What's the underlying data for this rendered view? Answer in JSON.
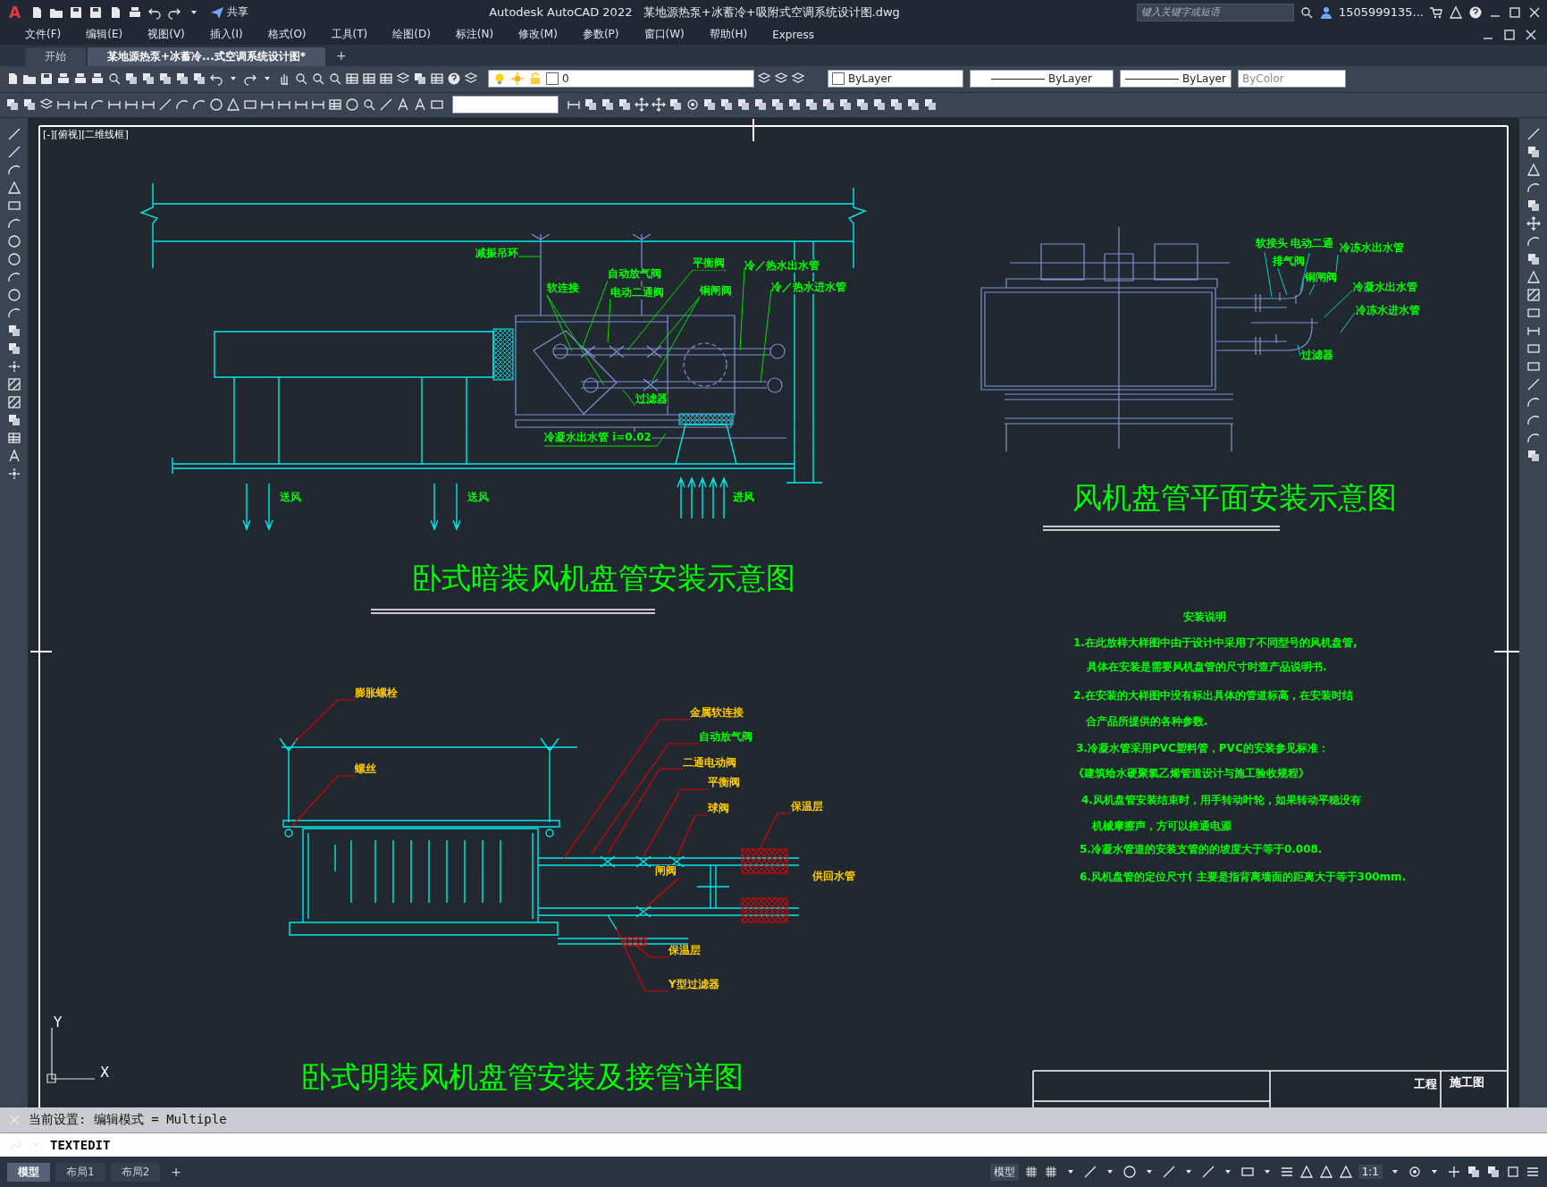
{
  "title_bar": {
    "app_menu": "A",
    "share": "共享",
    "title": "Autodesk AutoCAD 2022   某地源热泵+冰蓄冷+吸附式空调系统设计图.dwg",
    "search": {
      "placeholder": "键入关键字或短语"
    },
    "user": "1505999135..."
  },
  "menu_bar": [
    "文件(F)",
    "编辑(E)",
    "视图(V)",
    "插入(I)",
    "格式(O)",
    "工具(T)",
    "绘图(D)",
    "标注(N)",
    "修改(M)",
    "参数(P)",
    "窗口(W)",
    "帮助(H)",
    "Express"
  ],
  "file_tabs": [
    {
      "label": "开始",
      "selected": false
    },
    {
      "label": "某地源热泵+冰蓄冷...式空调系统设计图*",
      "selected": true
    }
  ],
  "new_tab": "+",
  "properties_toolbar": {
    "layer": "0",
    "color_control": "ByLayer",
    "linetype": "ByLayer",
    "lineweight": "ByLayer",
    "plot_style": "ByColor"
  },
  "drawing": {
    "labels": [
      {
        "text": "[-][俯视][二维线框]",
        "kind": "view",
        "color": "#ffffff"
      },
      {
        "text": "减振吊环",
        "kind": "callout",
        "color": "#00ff00"
      },
      {
        "text": "软连接",
        "kind": "callout",
        "color": "#00ff00"
      },
      {
        "text": "自动放气阀",
        "kind": "callout",
        "color": "#00ff00"
      },
      {
        "text": "电动二通阀",
        "kind": "callout",
        "color": "#00ff00"
      },
      {
        "text": "平衡阀",
        "kind": "callout",
        "color": "#00ff00"
      },
      {
        "text": "铜闸阀",
        "kind": "callout",
        "color": "#00ff00"
      },
      {
        "text": "冷／热水出水管",
        "kind": "callout",
        "color": "#00ff00"
      },
      {
        "text": "冷／热水进水管",
        "kind": "callout",
        "color": "#00ff00"
      },
      {
        "text": "过滤器",
        "kind": "callout",
        "color": "#00ff00"
      },
      {
        "text": "冷凝水出水管 i=0.02",
        "kind": "callout",
        "color": "#00ff00"
      },
      {
        "text": "送风",
        "kind": "callout",
        "color": "#00ff00"
      },
      {
        "text": "送风",
        "kind": "callout",
        "color": "#00ff00"
      },
      {
        "text": "进风",
        "kind": "callout",
        "color": "#00ff00"
      },
      {
        "text": "卧式暗装风机盘管安装示意图",
        "kind": "title",
        "color": "#00ff00"
      },
      {
        "text": "软接头",
        "kind": "callout",
        "color": "#00ff00"
      },
      {
        "text": "电动二通",
        "kind": "callout",
        "color": "#00ff00"
      },
      {
        "text": "排气阀",
        "kind": "callout",
        "color": "#00ff00"
      },
      {
        "text": "冷冻水出水管",
        "kind": "callout",
        "color": "#00ff00"
      },
      {
        "text": "铜闸阀",
        "kind": "callout",
        "color": "#00ff00"
      },
      {
        "text": "冷凝水出水管",
        "kind": "callout",
        "color": "#00ff00"
      },
      {
        "text": "冷冻水进水管",
        "kind": "callout",
        "color": "#00ff00"
      },
      {
        "text": "过滤器",
        "kind": "callout",
        "color": "#00ff00"
      },
      {
        "text": "风机盘管平面安装示意图",
        "kind": "title",
        "color": "#00ff00"
      },
      {
        "text": "安装说明",
        "kind": "heading",
        "color": "#00ff00"
      },
      {
        "text": "1.在此放样大样图中由于设计中采用了不同型号的风机盘管,",
        "kind": "note",
        "color": "#00ff00"
      },
      {
        "text": "具体在安装是需要风机盘管的尺寸时查产品说明书.",
        "kind": "note",
        "color": "#00ff00"
      },
      {
        "text": "2.在安装的大样图中没有标出具体的管道标高，在安装时结",
        "kind": "note",
        "color": "#00ff00"
      },
      {
        "text": "合产品所提供的各种参数.",
        "kind": "note",
        "color": "#00ff00"
      },
      {
        "text": "3.冷凝水管采用PVC塑料管，PVC的安装参见标准：",
        "kind": "note",
        "color": "#00ff00"
      },
      {
        "text": "《建筑给水硬聚氯乙烯管道设计与施工验收规程》",
        "kind": "note",
        "color": "#00ff00"
      },
      {
        "text": "4.风机盘管安装结束时，用手转动叶轮，如果转动平稳没有",
        "kind": "note",
        "color": "#00ff00"
      },
      {
        "text": "机械摩擦声，方可以接通电源",
        "kind": "note",
        "color": "#00ff00"
      },
      {
        "text": "5.冷凝水管道的安装支管的的坡度大于等于0.008.",
        "kind": "note",
        "color": "#00ff00"
      },
      {
        "text": "6.风机盘管的定位尺寸( 主要是指背离墙面的距离大于等于300mm.",
        "kind": "note",
        "color": "#00ff00"
      },
      {
        "text": "膨胀螺栓",
        "kind": "callout",
        "color": "#ffcc00"
      },
      {
        "text": "螺丝",
        "kind": "callout",
        "color": "#ffcc00"
      },
      {
        "text": "金属软连接",
        "kind": "callout",
        "color": "#ffcc00"
      },
      {
        "text": "自动放气阀",
        "kind": "callout",
        "color": "#00ff00"
      },
      {
        "text": "二通电动阀",
        "kind": "callout",
        "color": "#ffcc00"
      },
      {
        "text": "平衡阀",
        "kind": "callout",
        "color": "#ffcc00"
      },
      {
        "text": "球阀",
        "kind": "callout",
        "color": "#ffcc00"
      },
      {
        "text": "保温层",
        "kind": "callout",
        "color": "#ffcc00"
      },
      {
        "text": "闸阀",
        "kind": "callout",
        "color": "#ffcc00"
      },
      {
        "text": "供回水管",
        "kind": "callout",
        "color": "#ffcc00"
      },
      {
        "text": "保温层",
        "kind": "callout",
        "color": "#ffcc00"
      },
      {
        "text": "Y型过滤器",
        "kind": "callout",
        "color": "#ffcc00"
      },
      {
        "text": "卧式明装风机盘管安装及接管详图",
        "kind": "title",
        "color": "#00ff00"
      },
      {
        "text": "Y",
        "kind": "axis",
        "color": "#ffffff"
      },
      {
        "text": "X",
        "kind": "axis",
        "color": "#ffffff"
      },
      {
        "text": "工程",
        "kind": "cell",
        "color": "#ffffff"
      },
      {
        "text": "施工图",
        "kind": "cell",
        "color": "#ffffff"
      }
    ]
  },
  "command_line": {
    "history": "当前设置: 编辑模式 = Multiple",
    "input": "TEXTEDIT"
  },
  "layout_tabs": [
    {
      "label": "模型",
      "selected": true
    },
    {
      "label": "布局1",
      "selected": false
    },
    {
      "label": "布局2",
      "selected": false
    }
  ],
  "add_layout": "+",
  "status_bar": {
    "space": "模型",
    "scale": "1:1"
  }
}
